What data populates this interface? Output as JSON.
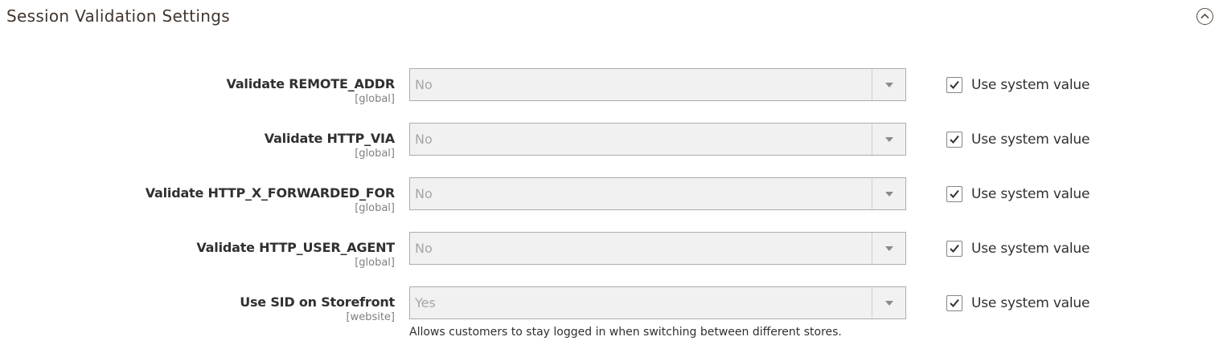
{
  "section": {
    "title": "Session Validation Settings",
    "toggle_icon": "chevron-up-circle-icon"
  },
  "rows": [
    {
      "label": "Validate REMOTE_ADDR",
      "scope": "[global]",
      "value": "No",
      "use_system_label": "Use system value",
      "use_system_checked": true
    },
    {
      "label": "Validate HTTP_VIA",
      "scope": "[global]",
      "value": "No",
      "use_system_label": "Use system value",
      "use_system_checked": true
    },
    {
      "label": "Validate HTTP_X_FORWARDED_FOR",
      "scope": "[global]",
      "value": "No",
      "use_system_label": "Use system value",
      "use_system_checked": true
    },
    {
      "label": "Validate HTTP_USER_AGENT",
      "scope": "[global]",
      "value": "No",
      "use_system_label": "Use system value",
      "use_system_checked": true
    },
    {
      "label": "Use SID on Storefront",
      "scope": "[website]",
      "value": "Yes",
      "use_system_label": "Use system value",
      "use_system_checked": true,
      "note": "Allows customers to stay logged in when switching between different stores."
    }
  ],
  "colors": {
    "select_background": "#f1f1f1",
    "select_border": "#adadad",
    "disabled_text": "#a6a6a6",
    "label_text": "#303030",
    "scope_text": "#808080"
  }
}
